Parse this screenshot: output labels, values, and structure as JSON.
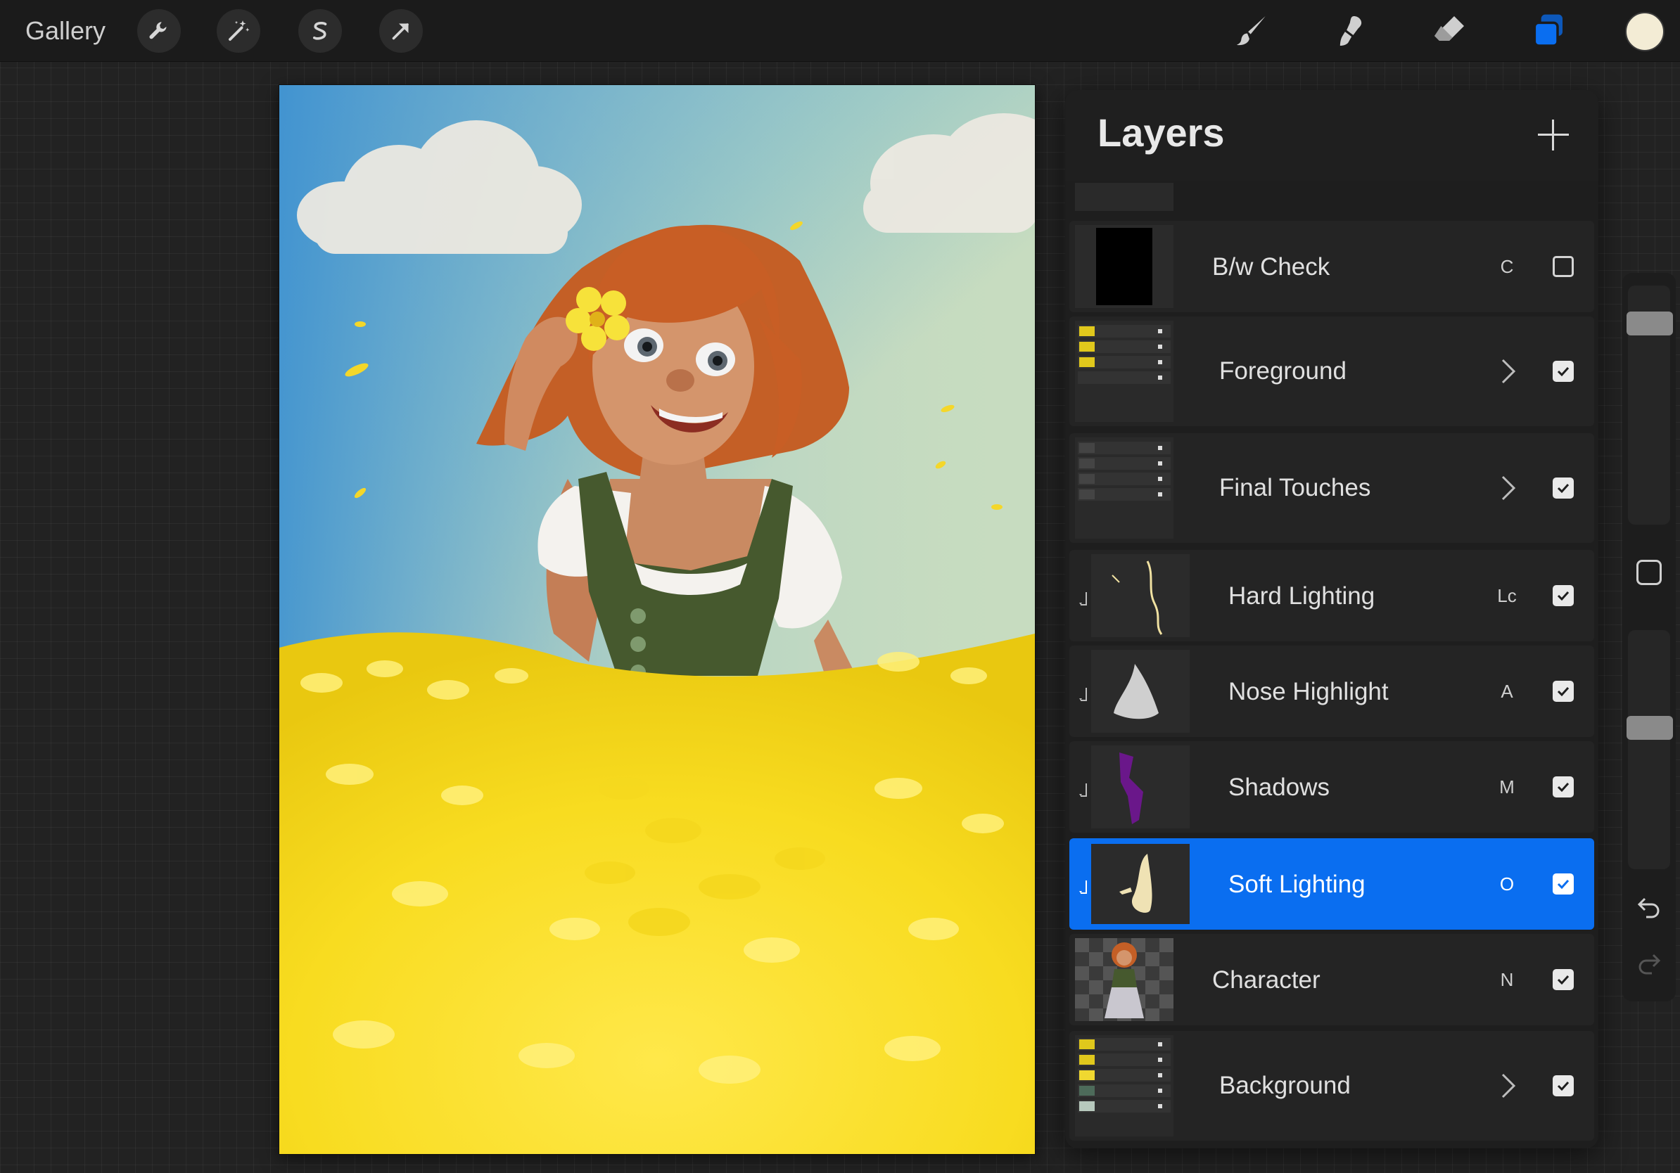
{
  "toolbar": {
    "gallery_label": "Gallery",
    "left_tools": [
      {
        "icon": "wrench-icon",
        "name": "actions"
      },
      {
        "icon": "magic-wand-icon",
        "name": "adjustments"
      },
      {
        "icon": "selection-s-icon",
        "name": "selection"
      },
      {
        "icon": "arrow-cursor-icon",
        "name": "transform"
      }
    ],
    "right_tools": [
      {
        "icon": "brush-icon",
        "name": "paint"
      },
      {
        "icon": "smudge-icon",
        "name": "smudge"
      },
      {
        "icon": "eraser-icon",
        "name": "erase"
      },
      {
        "icon": "layers-icon",
        "name": "layers",
        "active": true
      }
    ],
    "current_color": "#f3ecd5",
    "accent_color": "#0a6ef0"
  },
  "layers_panel": {
    "title": "Layers",
    "layers": [
      {
        "name": "B/w Check",
        "blend": "C",
        "visible": false,
        "group": false,
        "clipped": false,
        "selected": false
      },
      {
        "name": "Foreground",
        "blend": "",
        "visible": true,
        "group": true,
        "clipped": false,
        "selected": false
      },
      {
        "name": "Final Touches",
        "blend": "",
        "visible": true,
        "group": true,
        "clipped": false,
        "selected": false
      },
      {
        "name": "Hard Lighting",
        "blend": "Lc",
        "visible": true,
        "group": false,
        "clipped": true,
        "selected": false
      },
      {
        "name": "Nose Highlight",
        "blend": "A",
        "visible": true,
        "group": false,
        "clipped": true,
        "selected": false
      },
      {
        "name": "Shadows",
        "blend": "M",
        "visible": true,
        "group": false,
        "clipped": true,
        "selected": false
      },
      {
        "name": "Soft Lighting",
        "blend": "O",
        "visible": true,
        "group": false,
        "clipped": true,
        "selected": true
      },
      {
        "name": "Character",
        "blend": "N",
        "visible": true,
        "group": false,
        "clipped": false,
        "selected": false
      },
      {
        "name": "Background",
        "blend": "",
        "visible": true,
        "group": true,
        "clipped": false,
        "selected": false
      }
    ]
  },
  "sidebar": {
    "brush_size_level": 0.12,
    "opacity_level": 0.4,
    "icons": [
      "modify-square-icon",
      "undo-icon",
      "redo-icon"
    ]
  }
}
